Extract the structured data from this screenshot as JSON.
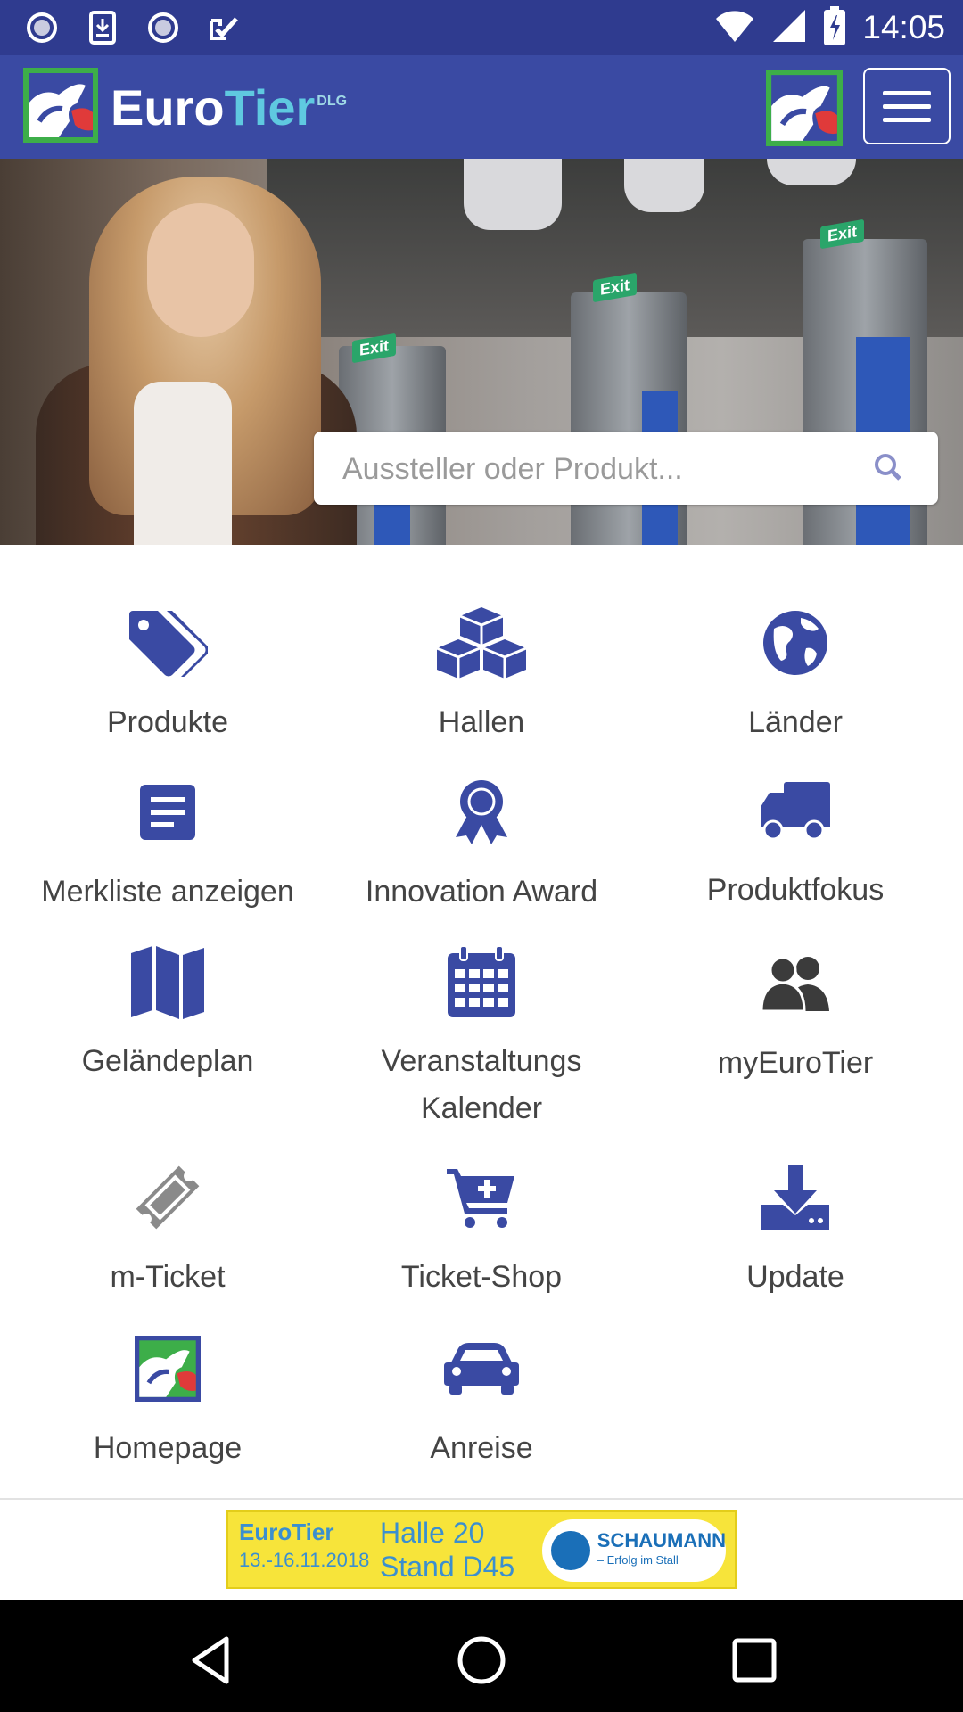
{
  "status_bar": {
    "time": "14:05",
    "left_icons": [
      "record-icon",
      "download-icon",
      "record-icon",
      "check-icon"
    ],
    "right_icons": [
      "wifi-icon",
      "signal-icon",
      "battery-icon"
    ]
  },
  "header": {
    "brand_part1": "Euro",
    "brand_part2": "Tier",
    "brand_mark": "DLG"
  },
  "search": {
    "placeholder": "Aussteller oder Produkt..."
  },
  "menu": {
    "items": [
      {
        "label": "Produkte",
        "icon": "tags-icon"
      },
      {
        "label": "Hallen",
        "icon": "cubes-icon"
      },
      {
        "label": "Länder",
        "icon": "globe-icon"
      },
      {
        "label": "Merkliste anzeigen",
        "icon": "list-icon"
      },
      {
        "label": "Innovation Award",
        "icon": "award-icon"
      },
      {
        "label": "Produktfokus",
        "icon": "truck-icon"
      },
      {
        "label": "Geländeplan",
        "icon": "map-icon"
      },
      {
        "label": "Veranstaltungs Kalender",
        "label_line1": "Veranstaltungs",
        "label_line2": "Kalender",
        "icon": "calendar-icon"
      },
      {
        "label": "myEuroTier",
        "icon": "users-icon"
      },
      {
        "label": "m-Ticket",
        "icon": "ticket-icon"
      },
      {
        "label": "Ticket-Shop",
        "icon": "cart-plus-icon"
      },
      {
        "label": "Update",
        "icon": "download-icon"
      },
      {
        "label": "Homepage",
        "icon": "eurotier-logo-icon"
      },
      {
        "label": "Anreise",
        "icon": "car-icon"
      }
    ]
  },
  "banner": {
    "brand": "EuroTier",
    "dates": "13.-16.11.2018",
    "hall": "Halle 20",
    "stand": "Stand D45",
    "sponsor": "SCHAUMANN",
    "sponsor_slogan": "– Erfolg im Stall"
  },
  "colors": {
    "primary": "#3a4aa3",
    "status_bar": "#2f3b8f",
    "icon": "#3a4aa3",
    "icon_gray": "#8a8a8a",
    "accent_cyan": "#5fc9e0",
    "banner_yellow": "#f7e43a"
  }
}
